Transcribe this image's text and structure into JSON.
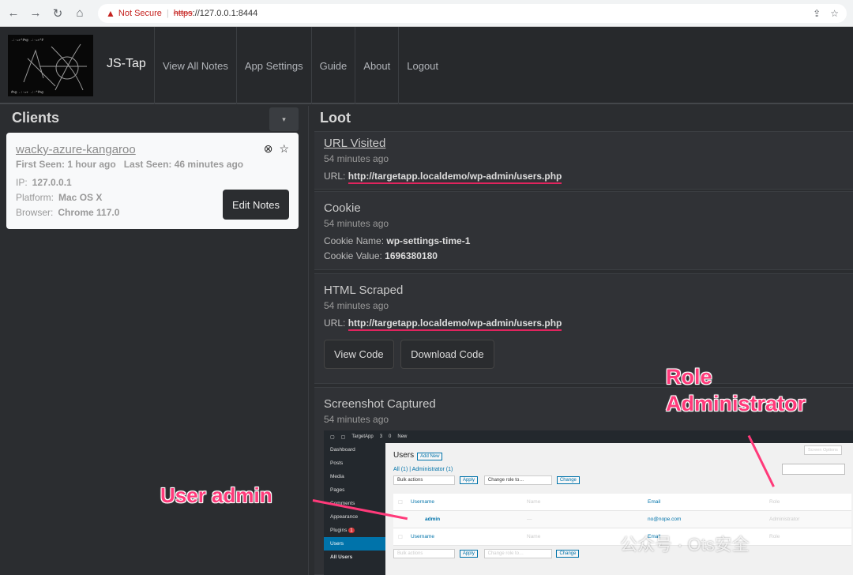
{
  "browser": {
    "security_label": "Not Secure",
    "scheme": "https",
    "host": "://127.0.0.1:8444"
  },
  "app": {
    "brand": "JS-Tap",
    "nav": [
      "View All Notes",
      "App Settings",
      "Guide",
      "About",
      "Logout"
    ]
  },
  "clients": {
    "title": "Clients",
    "items": [
      {
        "name": "wacky-azure-kangaroo",
        "first_seen_label": "First Seen:",
        "first_seen": "1 hour ago",
        "last_seen_label": "Last Seen:",
        "last_seen": "46 minutes ago",
        "ip_label": "IP:",
        "ip": "127.0.0.1",
        "platform_label": "Platform:",
        "platform": "Mac OS X",
        "browser_label": "Browser:",
        "browser": "Chrome 117.0",
        "edit_label": "Edit Notes"
      }
    ]
  },
  "loot": {
    "title": "Loot",
    "cards": [
      {
        "title": "URL Visited",
        "ago": "54 minutes ago",
        "label": "URL:",
        "value": "http://targetapp.localdemo/wp-admin/users.php"
      },
      {
        "title": "Cookie",
        "ago": "54 minutes ago",
        "name_label": "Cookie Name:",
        "name": "wp-settings-time-1",
        "value_label": "Cookie Value:",
        "value": "1696380180"
      },
      {
        "title": "HTML Scraped",
        "ago": "54 minutes ago",
        "label": "URL:",
        "value": "http://targetapp.localdemo/wp-admin/users.php",
        "view_label": "View Code",
        "download_label": "Download Code"
      },
      {
        "title": "Screenshot Captured",
        "ago": "54 minutes ago"
      }
    ]
  },
  "screenshot": {
    "site": "TargetApp",
    "bar_counts": [
      "3",
      "0"
    ],
    "bar_new": "New",
    "menu": [
      "Dashboard",
      "Posts",
      "Media",
      "Pages",
      "Comments",
      "Appearance",
      "Plugins",
      "Users",
      "All Users"
    ],
    "plugins_badge": "1",
    "heading": "Users",
    "add_new": "Add New",
    "screen_options": "Screen Options",
    "filters": "All (1) | Administrator (1)",
    "bulk": "Bulk actions",
    "apply": "Apply",
    "change_role": "Change role to…",
    "change": "Change",
    "columns": [
      "Username",
      "Name",
      "Email",
      "Role"
    ],
    "row": {
      "username": "admin",
      "name": "—",
      "email": "no@nope.com",
      "role": "Administrator"
    }
  },
  "annotations": {
    "role": "Role\nAdministrator",
    "user": "User admin"
  },
  "watermark": "公众号 · Ots安全",
  "colors": {
    "annotation": "#ff3a7a",
    "underline": "#e0245e"
  }
}
